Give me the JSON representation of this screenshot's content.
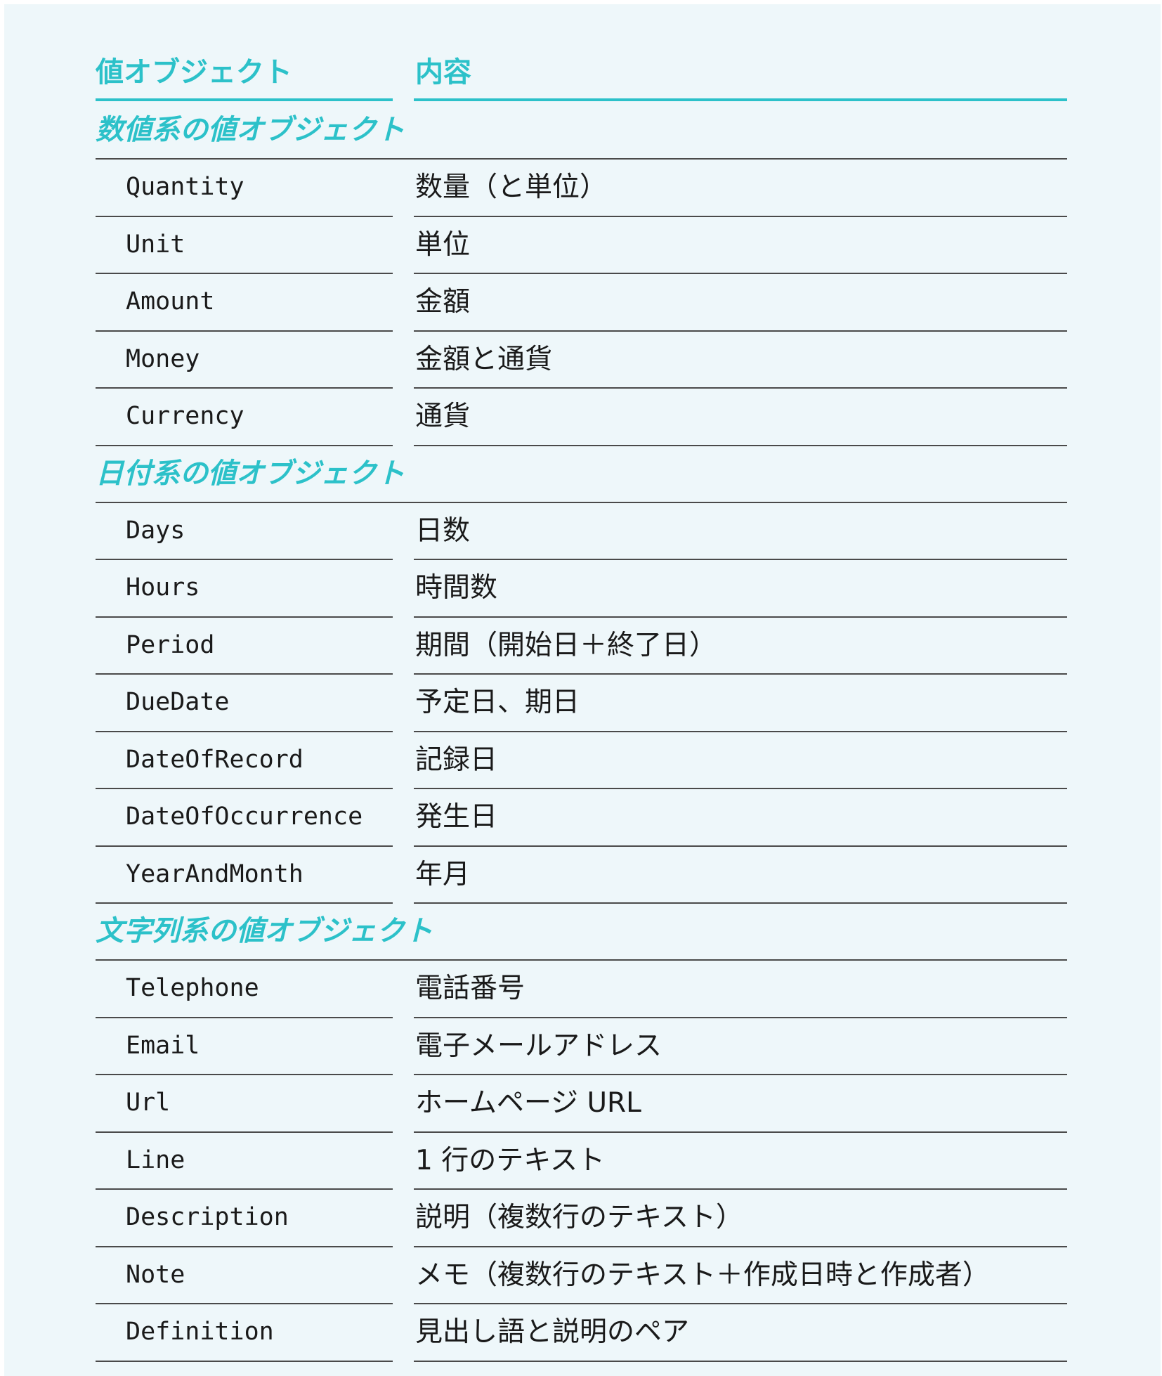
{
  "header": {
    "col_name": "値オブジェクト",
    "col_desc": "内容"
  },
  "sections": [
    {
      "title": "数値系の値オブジェクト",
      "rows": [
        {
          "name": "Quantity",
          "desc": "数量（と単位）"
        },
        {
          "name": "Unit",
          "desc": "単位"
        },
        {
          "name": "Amount",
          "desc": "金額"
        },
        {
          "name": "Money",
          "desc": "金額と通貨"
        },
        {
          "name": "Currency",
          "desc": "通貨"
        }
      ]
    },
    {
      "title": "日付系の値オブジェクト",
      "rows": [
        {
          "name": "Days",
          "desc": "日数"
        },
        {
          "name": "Hours",
          "desc": "時間数"
        },
        {
          "name": "Period",
          "desc": "期間（開始日＋終了日）"
        },
        {
          "name": "DueDate",
          "desc": "予定日、期日"
        },
        {
          "name": "DateOfRecord",
          "desc": "記録日"
        },
        {
          "name": "DateOfOccurrence",
          "desc": "発生日"
        },
        {
          "name": "YearAndMonth",
          "desc": "年月"
        }
      ]
    },
    {
      "title": "文字列系の値オブジェクト",
      "rows": [
        {
          "name": "Telephone",
          "desc": "電話番号"
        },
        {
          "name": "Email",
          "desc": "電子メールアドレス"
        },
        {
          "name": "Url",
          "desc": "ホームページ URL"
        },
        {
          "name": "Line",
          "desc": "1 行のテキスト"
        },
        {
          "name": "Description",
          "desc": "説明（複数行のテキスト）"
        },
        {
          "name": "Note",
          "desc": "メモ（複数行のテキスト＋作成日時と作成者）"
        },
        {
          "name": "Definition",
          "desc": "見出し語と説明のペア"
        }
      ]
    }
  ]
}
